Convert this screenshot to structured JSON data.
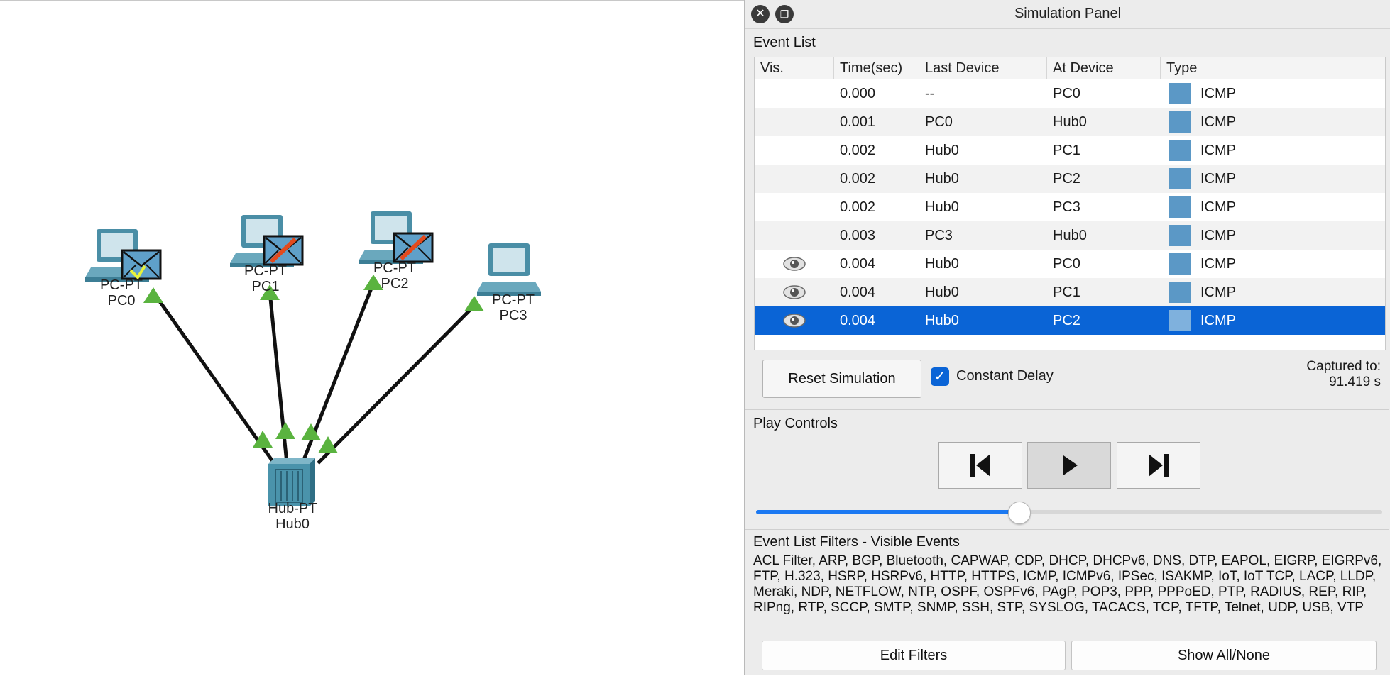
{
  "topology": {
    "devices": [
      {
        "id": "pc0",
        "type_label": "PC-PT",
        "name": "PC0"
      },
      {
        "id": "pc1",
        "type_label": "PC-PT",
        "name": "PC1"
      },
      {
        "id": "pc2",
        "type_label": "PC-PT",
        "name": "PC2"
      },
      {
        "id": "pc3",
        "type_label": "PC-PT",
        "name": "PC3"
      },
      {
        "id": "hub0",
        "type_label": "Hub-PT",
        "name": "Hub0"
      }
    ],
    "link_status_color": "#5ab33f",
    "device_color": "#3d8fa8"
  },
  "panel": {
    "title": "Simulation Panel",
    "close_icon": "close-icon",
    "restore_icon": "restore-icon",
    "event_list": {
      "label": "Event List",
      "columns": [
        "Vis.",
        "Time(sec)",
        "Last Device",
        "At Device",
        "Type"
      ],
      "rows": [
        {
          "vis": false,
          "time": "0.000",
          "last": "--",
          "at": "PC0",
          "type": "ICMP",
          "selected": false
        },
        {
          "vis": false,
          "time": "0.001",
          "last": "PC0",
          "at": "Hub0",
          "type": "ICMP",
          "selected": false
        },
        {
          "vis": false,
          "time": "0.002",
          "last": "Hub0",
          "at": "PC1",
          "type": "ICMP",
          "selected": false
        },
        {
          "vis": false,
          "time": "0.002",
          "last": "Hub0",
          "at": "PC2",
          "type": "ICMP",
          "selected": false
        },
        {
          "vis": false,
          "time": "0.002",
          "last": "Hub0",
          "at": "PC3",
          "type": "ICMP",
          "selected": false
        },
        {
          "vis": false,
          "time": "0.003",
          "last": "PC3",
          "at": "Hub0",
          "type": "ICMP",
          "selected": false
        },
        {
          "vis": true,
          "time": "0.004",
          "last": "Hub0",
          "at": "PC0",
          "type": "ICMP",
          "selected": false
        },
        {
          "vis": true,
          "time": "0.004",
          "last": "Hub0",
          "at": "PC1",
          "type": "ICMP",
          "selected": false
        },
        {
          "vis": true,
          "time": "0.004",
          "last": "Hub0",
          "at": "PC2",
          "type": "ICMP",
          "selected": true
        }
      ],
      "type_color": "#5b98c6",
      "type_color_selected": "#7fb1dd"
    },
    "reset_label": "Reset Simulation",
    "constant_delay_label": "Constant Delay",
    "constant_delay_checked": true,
    "captured_label": "Captured to:",
    "captured_value": "91.419 s",
    "play_controls": {
      "label": "Play Controls",
      "back_icon": "skip-back-icon",
      "play_icon": "play-icon",
      "forward_icon": "skip-forward-icon",
      "speed_fraction": 0.42
    },
    "filters": {
      "label": "Event List Filters - Visible Events",
      "text": "ACL Filter, ARP, BGP, Bluetooth, CAPWAP, CDP, DHCP, DHCPv6, DNS, DTP, EAPOL, EIGRP, EIGRPv6, FTP, H.323, HSRP, HSRPv6, HTTP, HTTPS, ICMP, ICMPv6, IPSec, ISAKMP, IoT, IoT TCP, LACP, LLDP, Meraki, NDP, NETFLOW, NTP, OSPF, OSPFv6, PAgP, POP3, PPP, PPPoED, PTP, RADIUS, REP, RIP, RIPng, RTP, SCCP, SMTP, SNMP, SSH, STP, SYSLOG, TACACS, TCP, TFTP, Telnet, UDP, USB, VTP",
      "edit_label": "Edit Filters",
      "show_all_label": "Show All/None"
    }
  }
}
